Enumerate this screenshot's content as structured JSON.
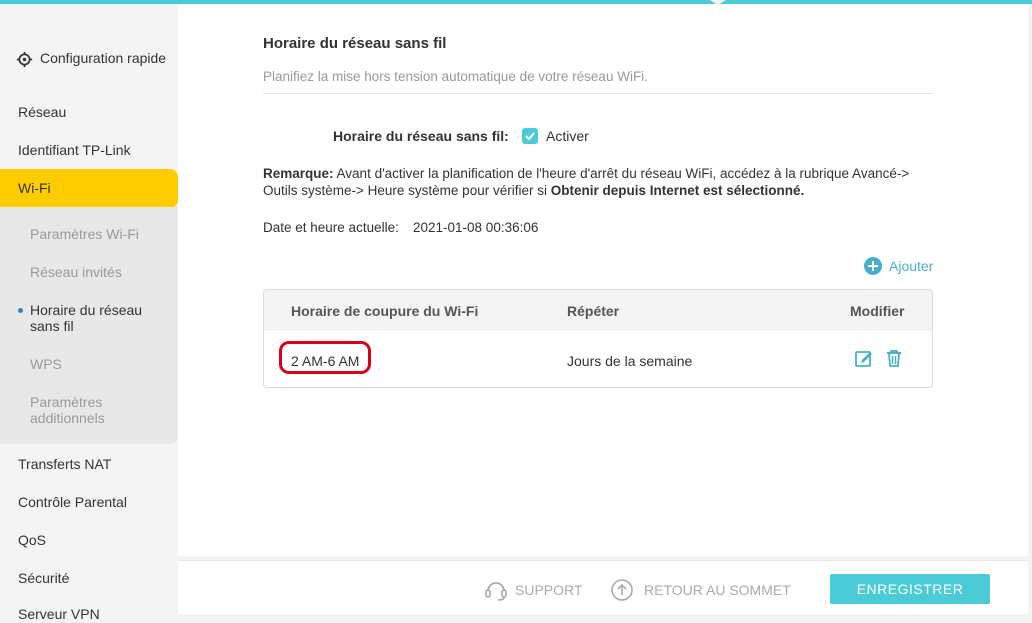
{
  "sidebar": {
    "quick_setup": "Configuration rapide",
    "items": [
      "Réseau",
      "Identifiant TP-Link",
      "Wi-Fi"
    ],
    "wifi_sub": [
      "Paramètres Wi-Fi",
      "Réseau invités",
      "Horaire du réseau sans fil",
      "WPS",
      "Paramètres additionnels"
    ],
    "items_after": [
      "Transferts NAT",
      "Contrôle Parental",
      "QoS",
      "Sécurité",
      "Serveur VPN"
    ]
  },
  "main": {
    "title": "Horaire du réseau sans fil",
    "subtitle": "Planifiez la mise hors tension automatique de votre réseau WiFi.",
    "schedule_label": "Horaire du réseau sans fil:",
    "enable_label": "Activer",
    "enabled": true,
    "note_bold": "Remarque:",
    "note_text": " Avant d'activer la planification de l'heure d'arrêt du réseau WiFi, accédez à la rubrique Avancé-> Outils système-> Heure système pour vérifier si ",
    "note_bold2": "Obtenir depuis Internet est sélectionné.",
    "datetime_label": "Date et heure actuelle:",
    "datetime_value": "2021-01-08 00:36:06",
    "add_label": "Ajouter"
  },
  "table": {
    "headers": [
      "Horaire de coupure du Wi-Fi",
      "Répéter",
      "Modifier"
    ],
    "rows": [
      {
        "time": "2 AM-6 AM",
        "repeat": "Jours de la semaine"
      }
    ]
  },
  "footer": {
    "support": "SUPPORT",
    "back_to_top": "RETOUR AU SOMMET",
    "save": "ENREGISTRER"
  },
  "colors": {
    "accent": "#4acbd6",
    "active_nav": "#ffcc00",
    "highlight": "#d9001b"
  }
}
